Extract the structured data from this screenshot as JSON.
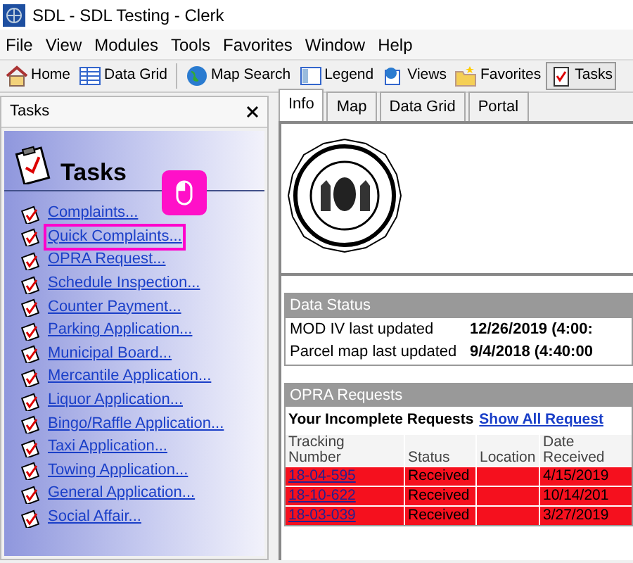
{
  "window": {
    "title": "SDL - SDL Testing - Clerk"
  },
  "menu": [
    "File",
    "View",
    "Modules",
    "Tools",
    "Favorites",
    "Window",
    "Help"
  ],
  "toolbar": [
    {
      "label": "Home",
      "kind": "home",
      "selected": false
    },
    {
      "label": "Data Grid",
      "kind": "grid",
      "selected": false
    },
    {
      "label": "Map Search",
      "kind": "globe",
      "selected": false
    },
    {
      "label": "Legend",
      "kind": "legend",
      "selected": false
    },
    {
      "label": "Views",
      "kind": "views",
      "selected": false
    },
    {
      "label": "Favorites",
      "kind": "folder",
      "selected": false
    },
    {
      "label": "Tasks",
      "kind": "tasks",
      "selected": true
    }
  ],
  "tasks_pane": {
    "title": "Tasks",
    "heading": "Tasks",
    "items": [
      {
        "label": "Complaints...",
        "highlighted": false
      },
      {
        "label": "Quick Complaints...",
        "highlighted": true
      },
      {
        "label": "OPRA Request...",
        "highlighted": false
      },
      {
        "label": "Schedule Inspection...",
        "highlighted": false
      },
      {
        "label": "Counter Payment...",
        "highlighted": false
      },
      {
        "label": "Parking Application...",
        "highlighted": false
      },
      {
        "label": "Municipal Board...",
        "highlighted": false
      },
      {
        "label": "Mercantile Application...",
        "highlighted": false
      },
      {
        "label": "Liquor Application...",
        "highlighted": false
      },
      {
        "label": "Bingo/Raffle Application...",
        "highlighted": false
      },
      {
        "label": "Taxi Application...",
        "highlighted": false
      },
      {
        "label": "Towing Application...",
        "highlighted": false
      },
      {
        "label": "General Application...",
        "highlighted": false
      },
      {
        "label": "Social Affair...",
        "highlighted": false
      }
    ]
  },
  "tabs": [
    {
      "label": "Info",
      "selected": true
    },
    {
      "label": "Map",
      "selected": false
    },
    {
      "label": "Data Grid",
      "selected": false
    },
    {
      "label": "Portal",
      "selected": false
    }
  ],
  "data_status": {
    "title": "Data Status",
    "rows": [
      {
        "label": "MOD IV last updated",
        "value": "12/26/2019 (4:00:"
      },
      {
        "label": "Parcel map last updated",
        "value": "9/4/2018 (4:40:00"
      }
    ]
  },
  "opra": {
    "title": "OPRA Requests",
    "heading": "Your Incomplete Requests",
    "link": "Show All Request",
    "columns": [
      "Tracking Number",
      "Status",
      "Location",
      "Date Received"
    ],
    "rows": [
      {
        "tracking": "18-04-595",
        "status": "Received",
        "location": "",
        "date": "4/15/2019"
      },
      {
        "tracking": "18-10-622",
        "status": "Received",
        "location": "",
        "date": "10/14/201"
      },
      {
        "tracking": "18-03-039",
        "status": "Received",
        "location": "",
        "date": "3/27/2019"
      }
    ]
  }
}
